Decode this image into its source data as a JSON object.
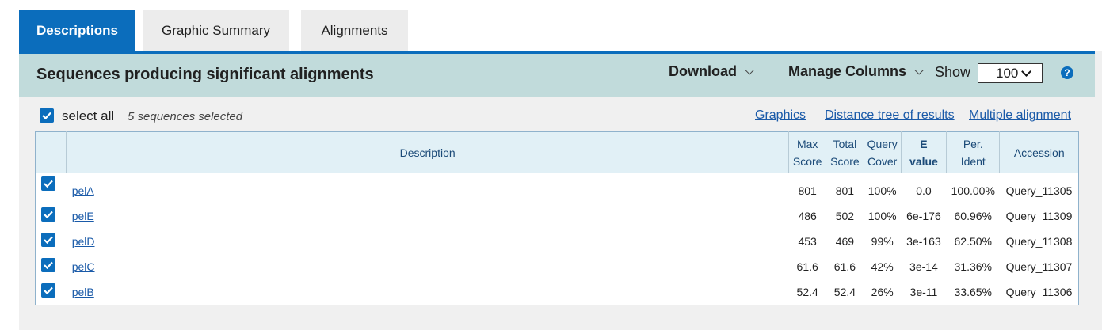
{
  "tabs": [
    {
      "label": "Descriptions",
      "active": true
    },
    {
      "label": "Graphic Summary",
      "active": false
    },
    {
      "label": "Alignments",
      "active": false
    }
  ],
  "header": {
    "title": "Sequences producing significant alignments",
    "download_label": "Download",
    "manage_columns_label": "Manage Columns",
    "show_label": "Show",
    "show_value": "100",
    "help_icon": "?"
  },
  "toolbar": {
    "select_all_label": "select all",
    "selected_count_text": "5 sequences selected",
    "graphics_link": "Graphics",
    "distance_tree_link": "Distance tree of results",
    "multiple_alignment_link": "Multiple alignment"
  },
  "table": {
    "columns": {
      "description": "Description",
      "max_score_1": "Max",
      "max_score_2": "Score",
      "total_score_1": "Total",
      "total_score_2": "Score",
      "query_cover_1": "Query",
      "query_cover_2": "Cover",
      "e_value_1": "E",
      "e_value_2": "value",
      "per_ident_1": "Per.",
      "per_ident_2": "Ident",
      "accession": "Accession"
    },
    "rows": [
      {
        "description": "pelA",
        "max_score": "801",
        "total_score": "801",
        "query_cover": "100%",
        "e_value": "0.0",
        "per_ident": "100.00%",
        "accession": "Query_11305",
        "checked": true
      },
      {
        "description": "pelE",
        "max_score": "486",
        "total_score": "502",
        "query_cover": "100%",
        "e_value": "6e-176",
        "per_ident": "60.96%",
        "accession": "Query_11309",
        "checked": true
      },
      {
        "description": "pelD",
        "max_score": "453",
        "total_score": "469",
        "query_cover": "99%",
        "e_value": "3e-163",
        "per_ident": "62.50%",
        "accession": "Query_11308",
        "checked": true
      },
      {
        "description": "pelC",
        "max_score": "61.6",
        "total_score": "61.6",
        "query_cover": "42%",
        "e_value": "3e-14",
        "per_ident": "31.36%",
        "accession": "Query_11307",
        "checked": true
      },
      {
        "description": "pelB",
        "max_score": "52.4",
        "total_score": "52.4",
        "query_cover": "26%",
        "e_value": "3e-11",
        "per_ident": "33.65%",
        "accession": "Query_11306",
        "checked": true
      }
    ]
  },
  "colors": {
    "accent": "#0b6dbc",
    "header_bg": "#c1dbdb",
    "panel_bg": "#f0f0f0",
    "link": "#1a5aa8"
  }
}
